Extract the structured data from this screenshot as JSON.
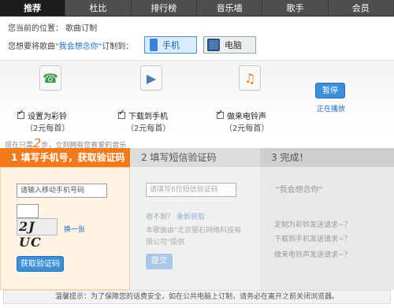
{
  "nav": {
    "items": [
      "推荐",
      "杜比",
      "排行榜",
      "音乐墙",
      "歌手",
      "会员"
    ],
    "active_color": "#1d1d1d"
  },
  "breadcrumb": "您当前的位置： 歌曲订制",
  "choose": {
    "prefix": "您想要将歌曲",
    "song": "\"我会想念你\"",
    "suffix": "订制到：",
    "phone_label": "手机",
    "pc_label": "电脑"
  },
  "options": [
    {
      "label": "设置为彩铃",
      "price": "（2元每首）",
      "icon": "ringtone-phone-icon"
    },
    {
      "label": "下载到手机",
      "price": "（2元每首）",
      "icon": "video-download-icon"
    },
    {
      "label": "做来电铃声",
      "price": "（2元每首）",
      "icon": "music-note-icon"
    }
  ],
  "player": {
    "pause_label": "暂停",
    "status": "正在播放"
  },
  "tip_steps": {
    "prefix": "现在只需",
    "number": "2",
    "suffix": "步，立刻拥有您喜爱的音乐"
  },
  "steps": [
    {
      "label": "1 填写手机号，获取验证码"
    },
    {
      "label": "2 填写短信验证码"
    },
    {
      "label": "3 完成！"
    }
  ],
  "step1": {
    "phone_placeholder": "请输入移动手机号码",
    "captcha_text": "2J UC",
    "refresh_label": "换一张",
    "get_code_label": "获取验证码"
  },
  "step2": {
    "code_placeholder": "请填写6位短信验证码",
    "not_received": "收不到？",
    "resend": "重新获取",
    "provider": "本歌曲由\"北京银石网络科技有限公司\"提供",
    "submit_label": "提交"
  },
  "step3": {
    "song": "\"我会想念你\"",
    "lines": [
      "定制为彩铃发送请求~？",
      "下载到手机发送请求~？",
      "做来电铃声发送请求~？"
    ]
  },
  "notice": "温馨提示：为了保障您的话费安全，如在公共电脑上订制，请务必在离开之前关闭浏览器。",
  "colors": {
    "orange": "#f37a1b",
    "blue": "#3b8ed8",
    "link": "#1a6fc4"
  }
}
